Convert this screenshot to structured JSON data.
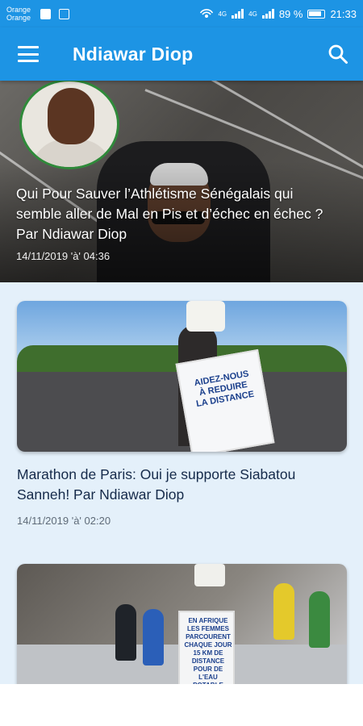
{
  "status_bar": {
    "carrier_1": "Orange",
    "carrier_2": "Orange",
    "signal_1": "4G",
    "signal_2": "4G",
    "battery": "89 %",
    "time": "21:33"
  },
  "app_bar": {
    "title": "Ndiawar Diop",
    "menu_icon": "menu-icon",
    "search_icon": "search-icon",
    "color": "#1d94e4"
  },
  "featured": {
    "title": "Qui Pour Sauver l’Athlétisme Sénégalais qui semble aller de Mal en Pis et d’échec en échec ? Par Ndiawar Diop",
    "date": "14/11/2019 'à' 04:36"
  },
  "articles": [
    {
      "title": "Marathon de Paris: Oui je supporte Siabatou Sanneh! Par Ndiawar Diop",
      "date": "14/11/2019 'à' 02:20",
      "image_sign_text": "AIDEZ-NOUS À REDUIRE LA DISTANCE"
    },
    {
      "image_sign_text": "EN AFRIQUE LES FEMMES PARCOURENT CHAQUE JOUR 15 KM DE DISTANCE POUR DE L'EAU POTABLE"
    }
  ],
  "colors": {
    "accent": "#1d94e4",
    "feed_background": "#e4f0fa",
    "title_text": "#152a4a"
  }
}
